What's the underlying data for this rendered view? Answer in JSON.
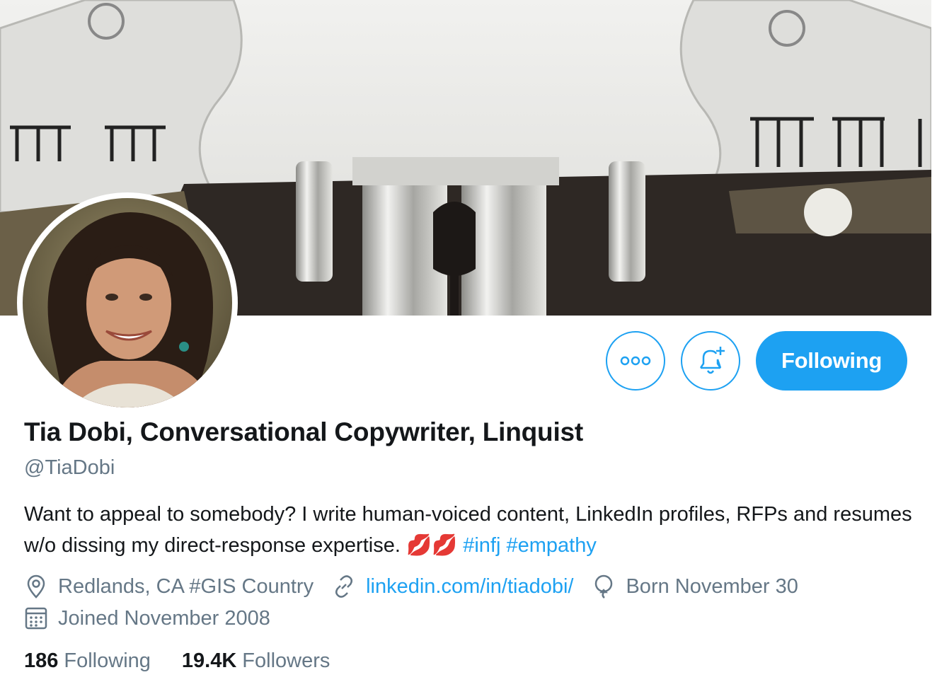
{
  "actions": {
    "more_label": "More",
    "notify_label": "Turn on notifications",
    "following_label": "Following"
  },
  "profile": {
    "name": "Tia Dobi, Conversational Copywriter, Linquist",
    "handle": "@TiaDobi",
    "bio_text": "Want to appeal to somebody? I write human-voiced content, LinkedIn profiles, RFPs and resumes w/o dissing my direct-response expertise. 💋💋 ",
    "bio_tags": [
      "#infj",
      "#empathy"
    ],
    "location": "Redlands, CA #GIS Country",
    "website": "linkedin.com/in/tiadobi/",
    "birthday": "Born November 30",
    "joined": "Joined November 2008"
  },
  "stats": {
    "following_count": "186",
    "following_label": "Following",
    "followers_count": "19.4K",
    "followers_label": "Followers"
  },
  "colors": {
    "accent": "#1da1f2",
    "secondary_text": "#657786"
  },
  "icons": [
    "more-icon",
    "bell-plus-icon",
    "location-icon",
    "link-icon",
    "balloon-icon",
    "calendar-icon"
  ]
}
